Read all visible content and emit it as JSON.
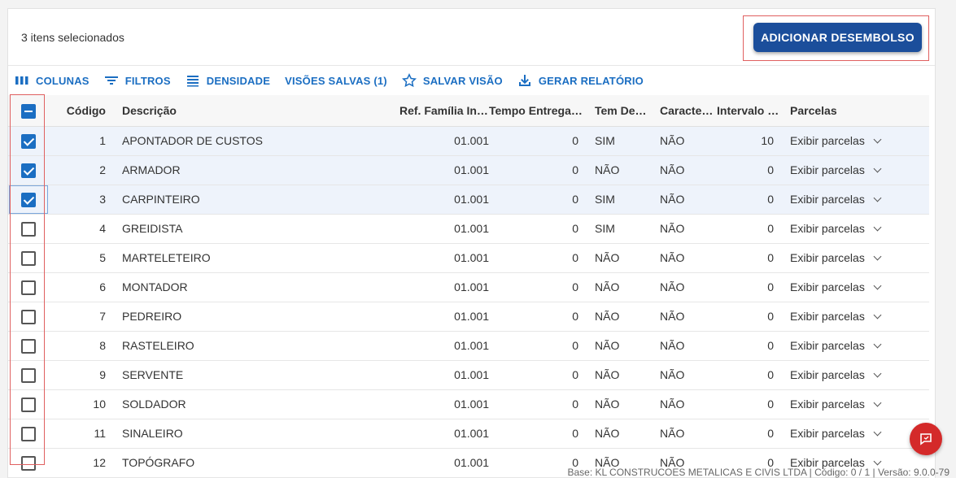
{
  "selection": {
    "count_label": "3 itens selecionados"
  },
  "actions": {
    "add_label": "ADICIONAR DESEMBOLSO"
  },
  "toolbar": {
    "columns": "COLUNAS",
    "filters": "FILTROS",
    "density": "DENSIDADE",
    "saved_views": "VISÕES SALVAS (1)",
    "save_view": "SALVAR VISÃO",
    "report": "GERAR RELATÓRIO"
  },
  "columns": {
    "codigo": "Código",
    "descricao": "Descrição",
    "ref_familia": "Ref. Família Ins…",
    "tempo_entrega": "Tempo Entrega…",
    "tem_des": "Tem Des…",
    "caracteristica": "Caracterí…",
    "intervalo": "Intervalo …",
    "parcelas": "Parcelas"
  },
  "rows": [
    {
      "codigo": "1",
      "descricao": "APONTADOR DE CUSTOS",
      "ref": "01.001",
      "tempo": "0",
      "tem_des": "SIM",
      "carac": "NÃO",
      "intervalo": "10",
      "parcelas": "Exibir parcelas",
      "checked": true
    },
    {
      "codigo": "2",
      "descricao": "ARMADOR",
      "ref": "01.001",
      "tempo": "0",
      "tem_des": "NÃO",
      "carac": "NÃO",
      "intervalo": "0",
      "parcelas": "Exibir parcelas",
      "checked": true
    },
    {
      "codigo": "3",
      "descricao": "CARPINTEIRO",
      "ref": "01.001",
      "tempo": "0",
      "tem_des": "SIM",
      "carac": "NÃO",
      "intervalo": "0",
      "parcelas": "Exibir parcelas",
      "checked": true
    },
    {
      "codigo": "4",
      "descricao": "GREIDISTA",
      "ref": "01.001",
      "tempo": "0",
      "tem_des": "SIM",
      "carac": "NÃO",
      "intervalo": "0",
      "parcelas": "Exibir parcelas",
      "checked": false
    },
    {
      "codigo": "5",
      "descricao": "MARTELETEIRO",
      "ref": "01.001",
      "tempo": "0",
      "tem_des": "NÃO",
      "carac": "NÃO",
      "intervalo": "0",
      "parcelas": "Exibir parcelas",
      "checked": false
    },
    {
      "codigo": "6",
      "descricao": "MONTADOR",
      "ref": "01.001",
      "tempo": "0",
      "tem_des": "NÃO",
      "carac": "NÃO",
      "intervalo": "0",
      "parcelas": "Exibir parcelas",
      "checked": false
    },
    {
      "codigo": "7",
      "descricao": "PEDREIRO",
      "ref": "01.001",
      "tempo": "0",
      "tem_des": "NÃO",
      "carac": "NÃO",
      "intervalo": "0",
      "parcelas": "Exibir parcelas",
      "checked": false
    },
    {
      "codigo": "8",
      "descricao": "RASTELEIRO",
      "ref": "01.001",
      "tempo": "0",
      "tem_des": "NÃO",
      "carac": "NÃO",
      "intervalo": "0",
      "parcelas": "Exibir parcelas",
      "checked": false
    },
    {
      "codigo": "9",
      "descricao": "SERVENTE",
      "ref": "01.001",
      "tempo": "0",
      "tem_des": "NÃO",
      "carac": "NÃO",
      "intervalo": "0",
      "parcelas": "Exibir parcelas",
      "checked": false
    },
    {
      "codigo": "10",
      "descricao": "SOLDADOR",
      "ref": "01.001",
      "tempo": "0",
      "tem_des": "NÃO",
      "carac": "NÃO",
      "intervalo": "0",
      "parcelas": "Exibir parcelas",
      "checked": false
    },
    {
      "codigo": "11",
      "descricao": "SINALEIRO",
      "ref": "01.001",
      "tempo": "0",
      "tem_des": "NÃO",
      "carac": "NÃO",
      "intervalo": "0",
      "parcelas": "Exibir parcelas",
      "checked": false
    },
    {
      "codigo": "12",
      "descricao": "TOPÓGRAFO",
      "ref": "01.001",
      "tempo": "0",
      "tem_des": "NÃO",
      "carac": "NÃO",
      "intervalo": "0",
      "parcelas": "Exibir parcelas",
      "checked": false
    }
  ],
  "footer": {
    "text": "Base: KL CONSTRUCOES METALICAS E CIVIS LTDA | Código: 0 / 1 | Versão: 9.0.0-79"
  },
  "colors": {
    "primary": "#1b4e9b",
    "link": "#1b6ec2",
    "fab": "#d42a2a",
    "highlight": "#e06060"
  }
}
